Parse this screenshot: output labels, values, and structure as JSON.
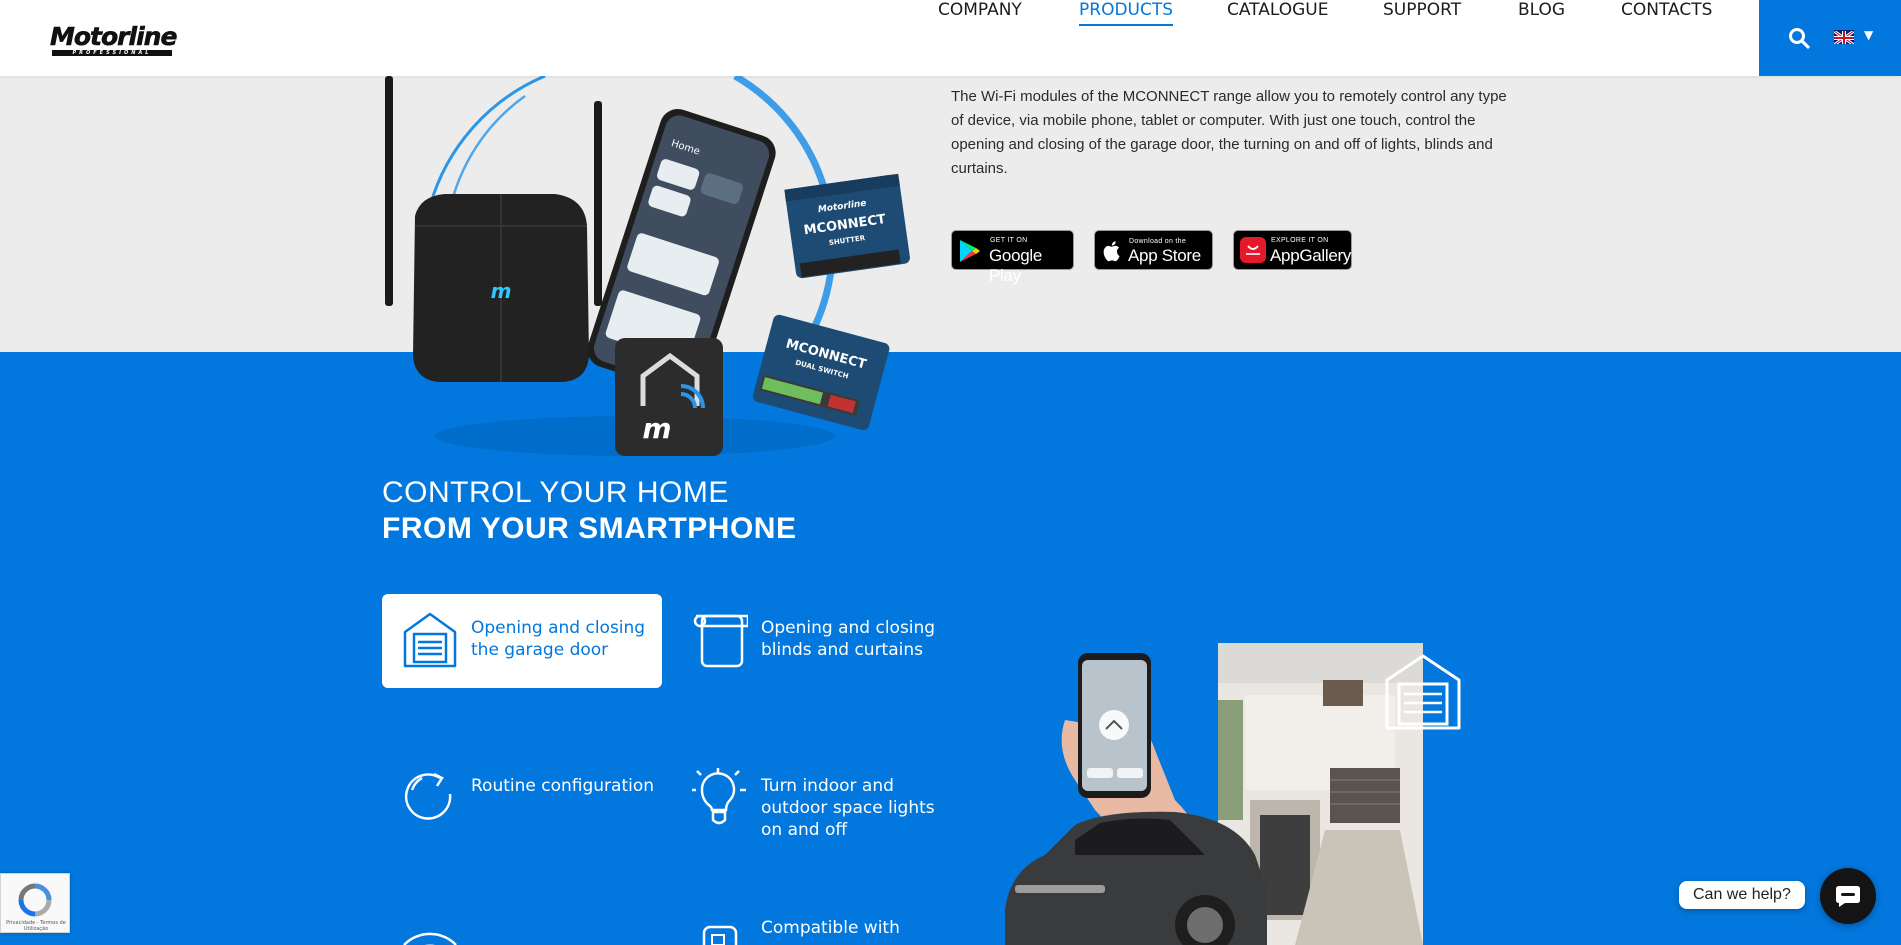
{
  "header": {
    "logo_text": "Motorline",
    "logo_sub": "PROFESSIONAL",
    "nav": [
      {
        "label": "COMPANY"
      },
      {
        "label": "PRODUCTS",
        "active": true
      },
      {
        "label": "CATALOGUE"
      },
      {
        "label": "SUPPORT"
      },
      {
        "label": "BLOG"
      },
      {
        "label": "CONTACTS"
      }
    ],
    "language": "EN"
  },
  "intro": {
    "text": "The Wi-Fi modules of the MCONNECT range allow you to remotely control any type of device, via mobile phone, tablet or computer. With just one touch, control the opening and closing of the garage door, the turning on and off of lights, blinds and curtains."
  },
  "stores": [
    {
      "small": "GET IT ON",
      "big": "Google Play"
    },
    {
      "small": "Download on the",
      "big": "App Store"
    },
    {
      "small": "EXPLORE IT ON",
      "big": "AppGallery"
    }
  ],
  "product_image": {
    "device_labels": [
      "MCONNECT SHUTTER",
      "MCONNECT DUAL SWITCH"
    ],
    "phone_title": "Home"
  },
  "section": {
    "heading_light": "CONTROL YOUR HOME",
    "heading_bold": "FROM YOUR SMARTPHONE"
  },
  "features": [
    {
      "label": "Opening and closing the garage door",
      "icon": "garage-door-icon",
      "active": true
    },
    {
      "label": "Opening and closing blinds and curtains",
      "icon": "blinds-icon"
    },
    {
      "label": "Routine configuration",
      "icon": "routine-icon"
    },
    {
      "label": "Turn indoor and outdoor space lights on and off",
      "icon": "lightbulb-icon"
    },
    {
      "label": "",
      "icon": "wifi-icon"
    },
    {
      "label": "Compatible with",
      "icon": "smartphone-icon"
    }
  ],
  "recaptcha": {
    "text": "Privacidade - Termos de Utilização"
  },
  "chat": {
    "label": "Can we help?"
  },
  "colors": {
    "brand_blue": "#0277dd",
    "band_grey": "#ececec"
  }
}
